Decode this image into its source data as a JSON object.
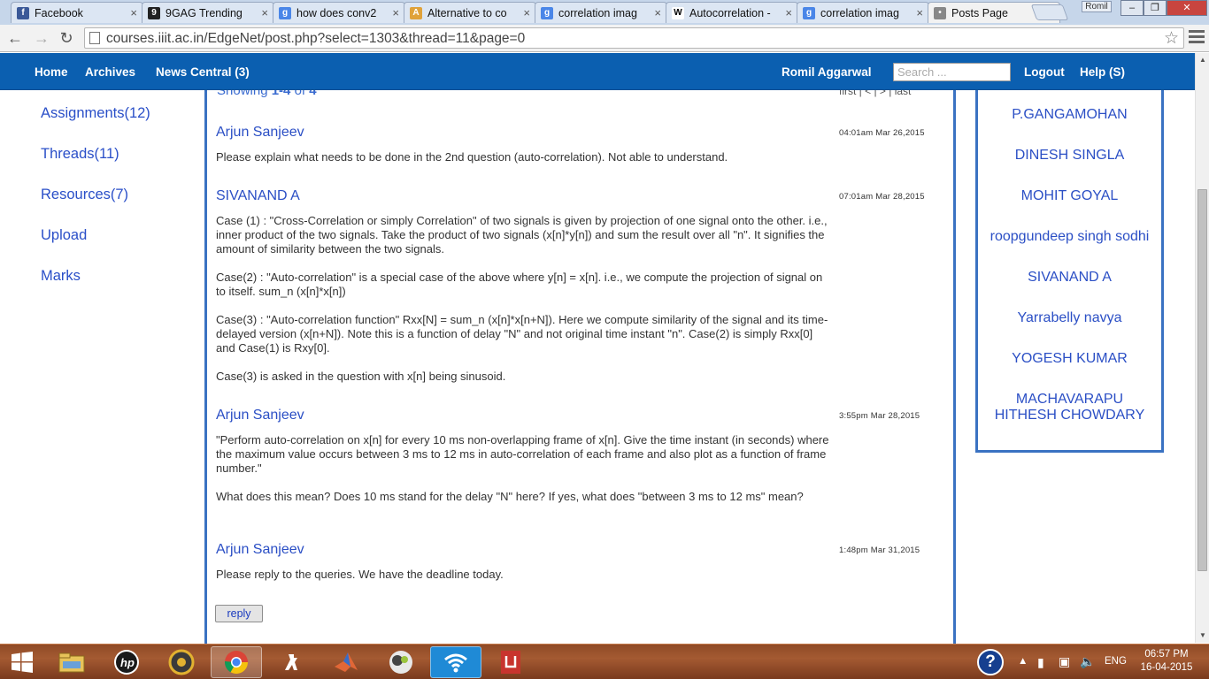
{
  "browser": {
    "tabs": [
      {
        "label": "Facebook",
        "icon": "facebook-icon",
        "color": "#3b5998"
      },
      {
        "label": "9GAG Trending",
        "icon": "9gag-icon",
        "color": "#222222"
      },
      {
        "label": "how does conv2",
        "icon": "google-icon",
        "color": "#4a86e8"
      },
      {
        "label": "Alternative to co",
        "icon": "page-icon",
        "color": "#e0a23a"
      },
      {
        "label": "correlation imag",
        "icon": "google-icon",
        "color": "#4a86e8"
      },
      {
        "label": "Autocorrelation -",
        "icon": "wikipedia-icon",
        "color": "#ffffff"
      },
      {
        "label": "correlation imag",
        "icon": "google-icon",
        "color": "#4a86e8"
      },
      {
        "label": "Posts Page",
        "icon": "loading-icon",
        "color": "#888888"
      }
    ],
    "user_badge": "Romil",
    "url": "courses.iiit.ac.in/EdgeNet/post.php?select=1303&thread=11&page=0"
  },
  "nav": {
    "home": "Home",
    "archives": "Archives",
    "news": "News Central (3)",
    "user": "Romil Aggarwal",
    "search_placeholder": "Search ...",
    "logout": "Logout",
    "help": "Help (S)"
  },
  "left_menu": [
    "Assignments(12)",
    "Threads(11)",
    "Resources(7)",
    "Upload",
    "Marks"
  ],
  "posts_header": {
    "showing_prefix": "Showing ",
    "showing_range": "1-4",
    "showing_of": " of ",
    "showing_total": "4",
    "pager": "first | < | > | last"
  },
  "posts": [
    {
      "author": "Arjun Sanjeev",
      "time": "04:01am Mar 26,2015",
      "paragraphs": [
        "Please explain what needs to be done in the 2nd question (auto-correlation). Not able to understand."
      ]
    },
    {
      "author": "SIVANAND A",
      "time": "07:01am Mar 28,2015",
      "paragraphs": [
        "Case (1) : \"Cross-Correlation or simply Correlation\" of two signals is given by projection of one signal onto the other. i.e., inner product of the two signals. Take the product of  two signals (x[n]*y[n]) and sum the result over all \"n\". It signifies the amount of similarity between the two signals.",
        "Case(2) : \"Auto-correlation\" is a special case of the above where y[n] = x[n]. i.e., we compute the projection of signal on to itself. sum_n (x[n]*x[n])",
        "Case(3) : \"Auto-correlation function\" Rxx[N] = sum_n (x[n]*x[n+N]). Here we compute similarity of the signal and its time-delayed version (x[n+N]). Note this is a function of delay \"N\" and not original time instant \"n\". Case(2) is simply Rxx[0] and Case(1) is Rxy[0].",
        "Case(3) is asked in the question with x[n] being sinusoid."
      ]
    },
    {
      "author": "Arjun Sanjeev",
      "time": "3:55pm Mar 28,2015",
      "paragraphs": [
        "\"Perform auto-correlation on x[n] for every 10 ms non-overlapping frame of x[n]. Give the time instant (in seconds) where the maximum value occurs between 3 ms to 12 ms in auto-correlation of each frame and also plot as a function of frame number.\"",
        "What does this mean? Does 10 ms stand for the delay \"N\" here? If yes, what does \"between 3 ms to 12 ms\" mean?"
      ]
    },
    {
      "author": "Arjun Sanjeev",
      "time": "1:48pm Mar 31,2015",
      "paragraphs": [
        "Please reply to the queries. We have the deadline today."
      ]
    }
  ],
  "reply_label": "reply",
  "users": [
    "P.GANGAMOHAN",
    "DINESH SINGLA",
    "MOHIT GOYAL",
    "roopgundeep singh sodhi",
    "SIVANAND A",
    "Yarrabelly navya",
    "YOGESH KUMAR",
    "MACHAVARAPU HITHESH CHOWDARY"
  ],
  "taskbar": {
    "apps": [
      "start-icon",
      "file-explorer-icon",
      "hp-icon",
      "disc-burner-icon",
      "chrome-icon",
      "counter-strike-icon",
      "matlab-icon",
      "chat-app-icon",
      "wifi-app-icon",
      "pdf-reader-icon"
    ],
    "language": "ENG",
    "time": "06:57 PM",
    "date": "16-04-2015"
  }
}
